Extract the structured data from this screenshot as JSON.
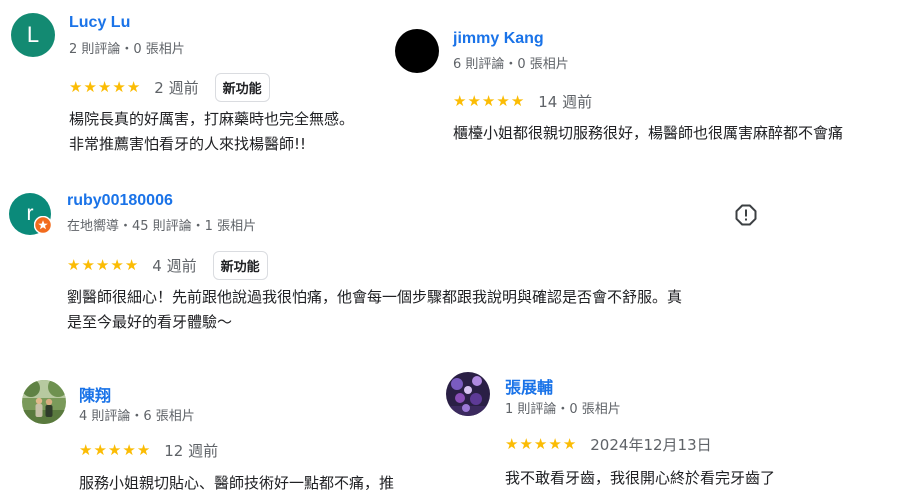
{
  "reviews": [
    {
      "name": "Lucy Lu",
      "avatar_initial": "L",
      "avatar_color": "#138a72",
      "meta": "2 則評論・0 張相片",
      "stars": 5,
      "time": "2 週前",
      "badge": "新功能",
      "text_lines": [
        "楊院長真的好厲害，打麻藥時也完全無感。",
        "非常推薦害怕看牙的人來找楊醫師!!"
      ]
    },
    {
      "name": "jimmy Kang",
      "avatar_color": "#000000",
      "meta": "6 則評論・0 張相片",
      "stars": 5,
      "time": "14 週前",
      "text_lines": [
        "櫃檯小姐都很親切服務很好，楊醫師也很厲害麻醉都不會痛"
      ]
    },
    {
      "name": "ruby00180006",
      "avatar_initial": "r",
      "avatar_color": "#0b8a7a",
      "meta": "在地嚮導・45 則評論・1 張相片",
      "stars": 5,
      "time": "4 週前",
      "badge": "新功能",
      "text_lines": [
        "劉醫師很細心！先前跟他說過我很怕痛，他會每一個步驟都跟我說明與確認是否會不舒服。真",
        "是至今最好的看牙體驗～"
      ]
    },
    {
      "name": "陳翔",
      "meta": "4 則評論・6 張相片",
      "stars": 5,
      "time": "12 週前",
      "text_lines": [
        "服務小姐親切貼心、醫師技術好一點都不痛，推"
      ]
    },
    {
      "name": "張展輔",
      "meta": "1 則評論・0 張相片",
      "stars": 5,
      "time": "2024年12月13日",
      "text_lines": [
        "我不敢看牙齒，我很開心終於看完牙齒了"
      ]
    }
  ],
  "colors": {
    "star": "#fbbc04",
    "link": "#1a73e8",
    "local_guide_badge": "#f26b1d"
  }
}
